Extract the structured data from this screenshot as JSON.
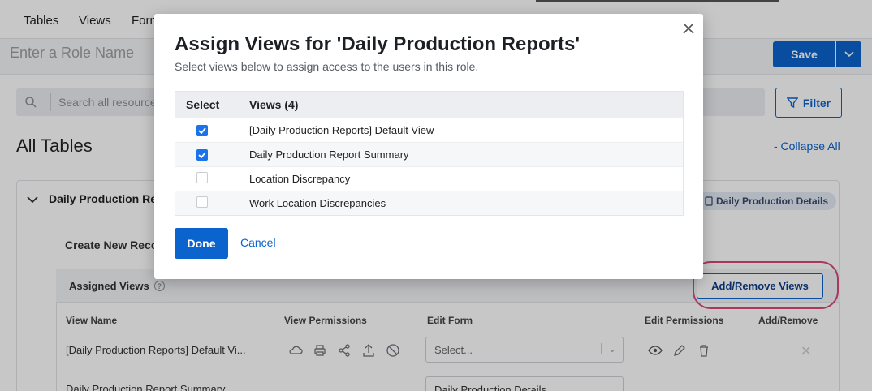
{
  "nav": {
    "tables": "Tables",
    "views": "Views",
    "forms": "Form"
  },
  "role": {
    "placeholder": "Enter a Role Name",
    "save_label": "Save"
  },
  "search": {
    "placeholder": "Search all resources"
  },
  "filter_label": "Filter",
  "section_title": "All Tables",
  "collapse_all": "- Collapse All",
  "card": {
    "title": "Daily Production Rep",
    "badge": "Daily Production Details",
    "create_new": "Create New Reco",
    "assigned_views_title": "Assigned Views",
    "add_remove_label": "Add/Remove Views",
    "columns": [
      "View Name",
      "View Permissions",
      "Edit Form",
      "Edit Permissions",
      "Add/Remove"
    ],
    "rows": [
      {
        "view_name": "[Daily Production Reports] Default Vi...",
        "edit_form": "Select..."
      },
      {
        "view_name": "Daily Production Report Summary",
        "edit_form": "Daily Production Details"
      }
    ]
  },
  "modal": {
    "title": "Assign Views for 'Daily Production Reports'",
    "subtitle": "Select views below to assign access to the users in this role.",
    "col_select": "Select",
    "col_views": "Views (4)",
    "views": [
      {
        "name": "[Daily Production Reports] Default View",
        "checked": true
      },
      {
        "name": "Daily Production Report Summary",
        "checked": true
      },
      {
        "name": "Location Discrepancy",
        "checked": false
      },
      {
        "name": "Work Location Discrepancies",
        "checked": false
      }
    ],
    "done_label": "Done",
    "cancel_label": "Cancel"
  },
  "colors": {
    "accent": "#0b63ce",
    "highlight": "#d84878",
    "checkbox": "#1a73e8"
  }
}
